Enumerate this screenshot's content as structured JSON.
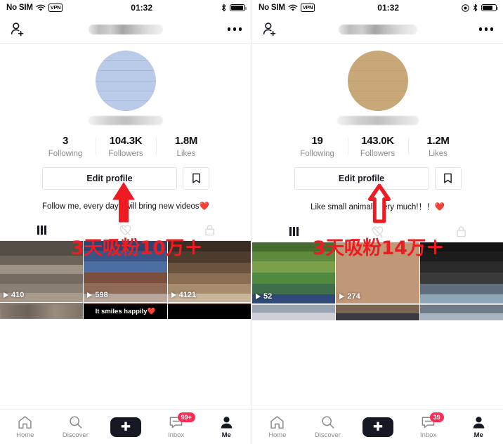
{
  "screens": [
    {
      "id": "left",
      "status_bar": {
        "carrier": "No SIM",
        "wifi_icon": "wifi-icon",
        "vpn_label": "VPN",
        "time": "01:32",
        "extra_icon": "",
        "bluetooth_icon": "bluetooth-icon",
        "battery_icon": "battery-icon",
        "battery_level_pct": 92
      },
      "header": {
        "add_friend_icon": "add-person-icon",
        "username_redacted": true,
        "more_icon": "more-options-icon"
      },
      "profile": {
        "avatar_redacted": true,
        "handle_redacted": true
      },
      "stats": [
        {
          "value": "3",
          "label": "Following"
        },
        {
          "value": "104.3K",
          "label": "Followers"
        },
        {
          "value": "1.8M",
          "label": "Likes"
        }
      ],
      "actions": {
        "edit_profile_label": "Edit profile",
        "bookmark_icon": "bookmark-icon"
      },
      "bio": "Follow me, every day I will bring new videos❤️",
      "overlay": {
        "arrow_icon": "up-arrow-annotation",
        "arrow_color": "#ef1b22",
        "text": "3天吸粉10万＋"
      },
      "tabs": [
        {
          "icon": "grid-icon",
          "active": true
        },
        {
          "icon": "heart-slash-icon",
          "active": false
        },
        {
          "icon": "lock-icon",
          "active": false
        }
      ],
      "videos": [
        {
          "views": "410",
          "caption": "",
          "caption_redacted": true,
          "thumb": "g1"
        },
        {
          "views": "598",
          "caption": "It smiles happily❤️",
          "caption_redacted": false,
          "thumb": "g2"
        },
        {
          "views": "4121",
          "caption": "",
          "caption_redacted": false,
          "thumb": "g3"
        }
      ],
      "bottom_nav": [
        {
          "label": "Home",
          "icon": "home-icon",
          "active": false,
          "badge": ""
        },
        {
          "label": "Discover",
          "icon": "search-icon",
          "active": false,
          "badge": ""
        },
        {
          "label": "",
          "icon": "create-icon",
          "active": false,
          "badge": ""
        },
        {
          "label": "Inbox",
          "icon": "inbox-icon",
          "active": false,
          "badge": "99+"
        },
        {
          "label": "Me",
          "icon": "person-icon",
          "active": true,
          "badge": ""
        }
      ]
    },
    {
      "id": "right",
      "status_bar": {
        "carrier": "No SIM",
        "wifi_icon": "wifi-icon",
        "vpn_label": "VPN",
        "time": "01:32",
        "extra_icon": "location-icon",
        "bluetooth_icon": "bluetooth-icon",
        "battery_icon": "battery-icon",
        "battery_level_pct": 78
      },
      "header": {
        "add_friend_icon": "add-person-icon",
        "username_redacted": true,
        "more_icon": "more-options-icon"
      },
      "profile": {
        "avatar_redacted": true,
        "handle_redacted": true
      },
      "stats": [
        {
          "value": "19",
          "label": "Following"
        },
        {
          "value": "143.0K",
          "label": "Followers"
        },
        {
          "value": "1.2M",
          "label": "Likes"
        }
      ],
      "actions": {
        "edit_profile_label": "Edit profile",
        "bookmark_icon": "bookmark-icon"
      },
      "bio": "Like small animals very much!！！❤️",
      "overlay": {
        "arrow_icon": "up-arrow-annotation",
        "arrow_color": "#ef1b22",
        "text": "3天吸粉14万＋"
      },
      "tabs": [
        {
          "icon": "grid-icon",
          "active": true
        },
        {
          "icon": "heart-slash-icon",
          "active": false
        },
        {
          "icon": "lock-icon",
          "active": false
        }
      ],
      "videos": [
        {
          "views": "52",
          "caption": "",
          "caption_redacted": false,
          "thumb": "g4"
        },
        {
          "views": "274",
          "caption": "",
          "caption_redacted": false,
          "thumb": "g5"
        },
        {
          "views": "",
          "caption": "",
          "caption_redacted": false,
          "thumb": "g6"
        }
      ],
      "bottom_nav": [
        {
          "label": "Home",
          "icon": "home-icon",
          "active": false,
          "badge": ""
        },
        {
          "label": "Discover",
          "icon": "search-icon",
          "active": false,
          "badge": ""
        },
        {
          "label": "",
          "icon": "create-icon",
          "active": false,
          "badge": ""
        },
        {
          "label": "Inbox",
          "icon": "inbox-icon",
          "active": false,
          "badge": "39"
        },
        {
          "label": "Me",
          "icon": "person-icon",
          "active": true,
          "badge": ""
        }
      ]
    }
  ],
  "theme": {
    "accent_red": "#fe2c55",
    "accent_cyan": "#25f4ee",
    "annotation_red": "#ef1b22",
    "text_primary": "#161823",
    "text_muted": "#8c8c8c"
  }
}
